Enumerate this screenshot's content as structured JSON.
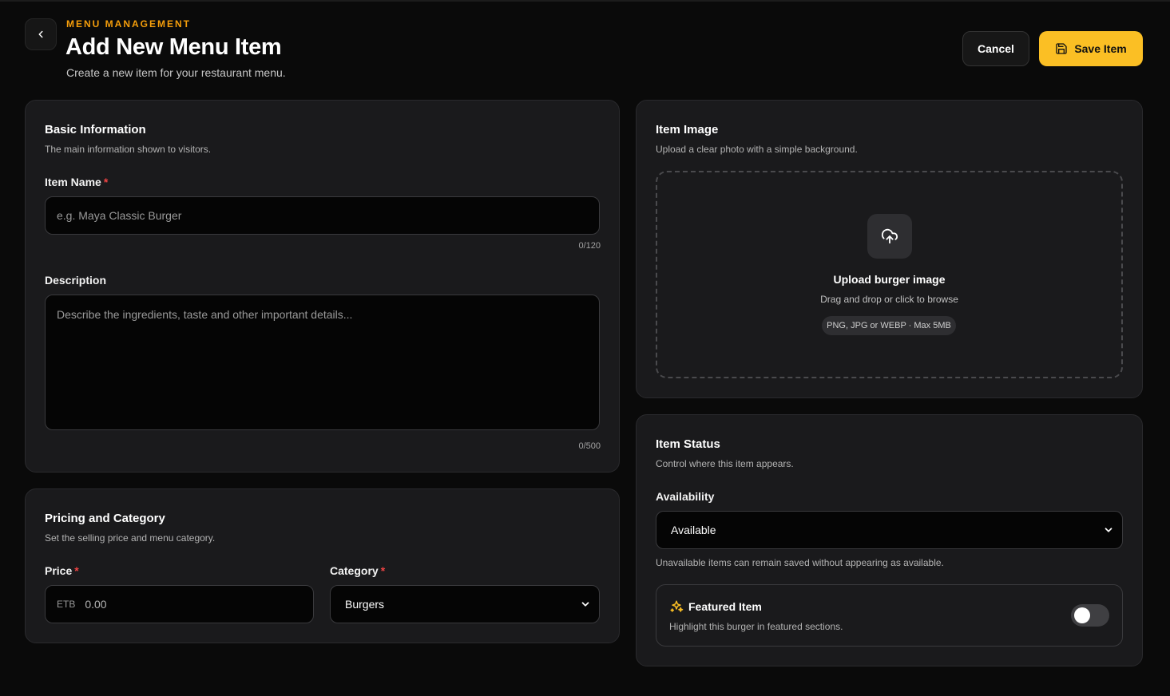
{
  "header": {
    "eyebrow": "MENU MANAGEMENT",
    "title": "Add New Menu Item",
    "subtitle": "Create a new item for your restaurant menu.",
    "cancel_label": "Cancel",
    "save_label": "Save Item"
  },
  "basic_info": {
    "title": "Basic Information",
    "description": "The main information shown to visitors.",
    "item_name_label": "Item Name",
    "required_mark": "*",
    "item_name_placeholder": "e.g. Maya Classic Burger",
    "item_name_counter": "0/120",
    "description_label": "Description",
    "description_placeholder": "Describe the ingredients, taste and other important details...",
    "description_counter": "0/500"
  },
  "pricing": {
    "title": "Pricing and Category",
    "description": "Set the selling price and menu category.",
    "price_label": "Price",
    "currency": "ETB",
    "price_placeholder": "0.00",
    "category_label": "Category",
    "category_value": "Burgers"
  },
  "image": {
    "title": "Item Image",
    "description": "Upload a clear photo with a simple background.",
    "upload_title": "Upload burger image",
    "upload_hint": "Drag and drop or click to browse",
    "upload_formats": "PNG, JPG or WEBP · Max 5MB"
  },
  "status": {
    "title": "Item Status",
    "description": "Control where this item appears.",
    "availability_label": "Availability",
    "availability_value": "Available",
    "availability_help": "Unavailable items can remain saved without appearing as available.",
    "featured_title": "Featured Item",
    "featured_desc": "Highlight this burger in featured sections.",
    "featured_on": false
  },
  "colors": {
    "accent": "#fbbf24",
    "eyebrow": "#f59e0b",
    "required": "#ef4444",
    "background": "#0a0a0a",
    "card": "#1a1a1c"
  },
  "icons": {
    "back": "chevron-left-icon",
    "save": "floppy-disk-icon",
    "upload": "cloud-upload-icon",
    "featured": "sparkles-icon",
    "dropdown": "chevron-down-icon"
  }
}
